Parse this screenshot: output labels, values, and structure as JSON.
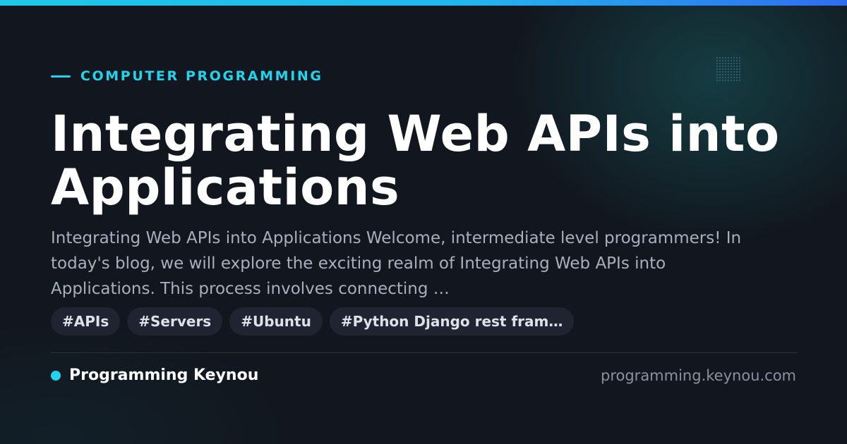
{
  "category": "COMPUTER PROGRAMMING",
  "title": "Integrating Web APIs into Applications",
  "summary": "Integrating Web APIs into Applications Welcome, intermediate level programmers! In today's blog, we will explore the exciting realm of Integrating Web APIs into Applications. This process involves connecting …",
  "tags": [
    "#APIs",
    "#Servers",
    "#Ubuntu",
    "#Python Django rest fram…"
  ],
  "brand": {
    "name": "Programming Keynou",
    "domain": "programming.keynou.com"
  },
  "colors": {
    "accent": "#22d3ee",
    "background": "#12161e",
    "tag_background": "#1f2430"
  }
}
